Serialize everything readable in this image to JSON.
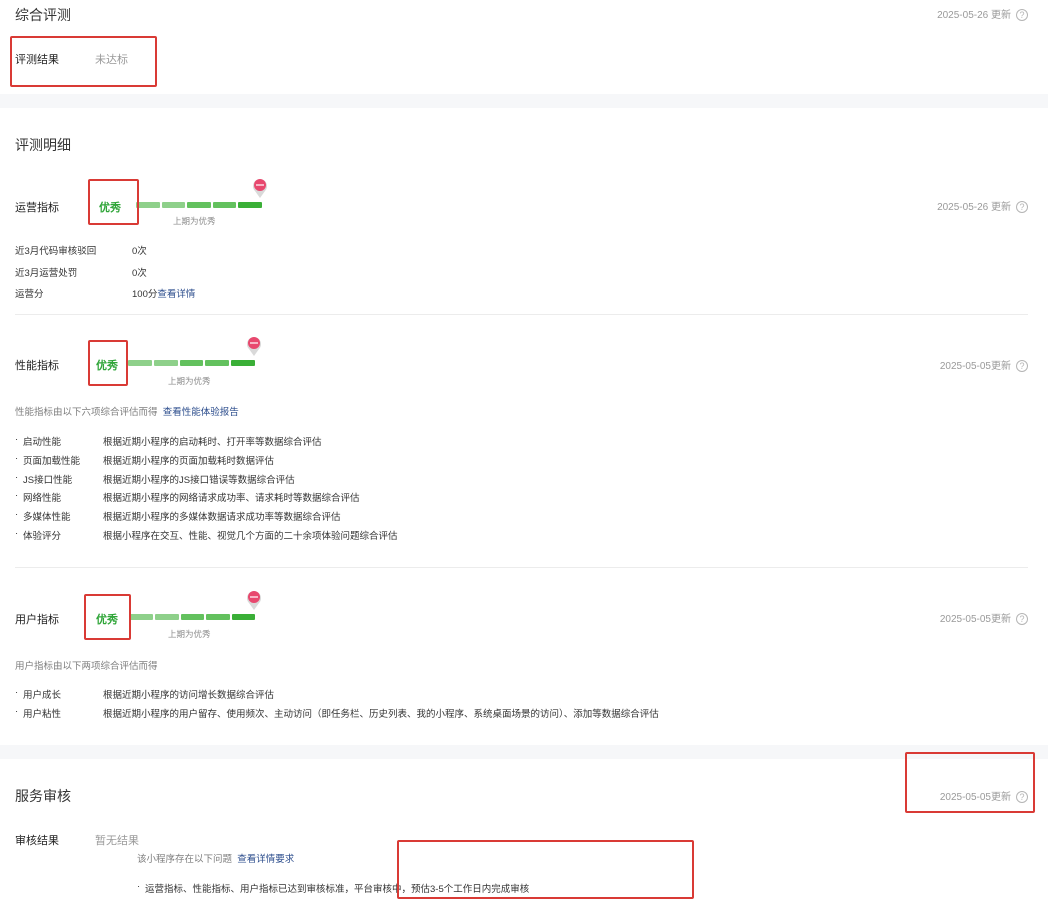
{
  "overall": {
    "title": "综合评测",
    "updated": "2025-05-26 更新",
    "result_label": "评测结果",
    "result_value": "未达标"
  },
  "details": {
    "title": "评测明细",
    "operation": {
      "label": "运营指标",
      "grade": "优秀",
      "previous": "上期为优秀",
      "updated": "2025-05-26 更新",
      "rows": [
        {
          "label": "近3月代码审核驳回",
          "value": "0次"
        },
        {
          "label": "近3月运营处罚",
          "value": "0次"
        },
        {
          "label": "运营分",
          "value": "100分"
        }
      ],
      "detail_link": "查看详情"
    },
    "performance": {
      "label": "性能指标",
      "grade": "优秀",
      "previous": "上期为优秀",
      "updated": "2025-05-05更新",
      "desc": "性能指标由以下六项综合评估而得",
      "report_link": "查看性能体验报告",
      "items": [
        {
          "name": "启动性能",
          "desc": "根据近期小程序的启动耗时、打开率等数据综合评估"
        },
        {
          "name": "页面加载性能",
          "desc": "根据近期小程序的页面加载耗时数据评估"
        },
        {
          "name": "JS接口性能",
          "desc": "根据近期小程序的JS接口错误等数据综合评估"
        },
        {
          "name": "网络性能",
          "desc": "根据近期小程序的网络请求成功率、请求耗时等数据综合评估"
        },
        {
          "name": "多媒体性能",
          "desc": "根据近期小程序的多媒体数据请求成功率等数据综合评估"
        },
        {
          "name": "体验评分",
          "desc": "根据小程序在交互、性能、视觉几个方面的二十余项体验问题综合评估"
        }
      ]
    },
    "user": {
      "label": "用户指标",
      "grade": "优秀",
      "previous": "上期为优秀",
      "updated": "2025-05-05更新",
      "desc": "用户指标由以下两项综合评估而得",
      "items": [
        {
          "name": "用户成长",
          "desc": "根据近期小程序的访问增长数据综合评估"
        },
        {
          "name": "用户粘性",
          "desc": "根据近期小程序的用户留存、使用频次、主动访问（即任务栏、历史列表、我的小程序、系统桌面场景的访问）、添加等数据综合评估"
        }
      ]
    }
  },
  "service": {
    "title": "服务审核",
    "updated": "2025-05-05更新",
    "result_label": "审核结果",
    "result_value": "暂无结果",
    "issue_text": "该小程序存在以下问题",
    "issue_link": "查看详情要求",
    "note": "运营指标、性能指标、用户指标已达到审核标准，平台审核中，预估3-5个工作日内完成审核"
  },
  "help_glyph": "?",
  "bullet_glyph": "·",
  "colors": {
    "grade_green": "#2fa538",
    "bar_light": "#8ed08a",
    "bar_dark": "#3aaf37",
    "link": "#2b4c8c",
    "highlight_red": "#d93a35",
    "pin_pink": "#e8486e"
  },
  "icons": {
    "help": "question-circle-icon",
    "pin": "map-pin-icon"
  }
}
